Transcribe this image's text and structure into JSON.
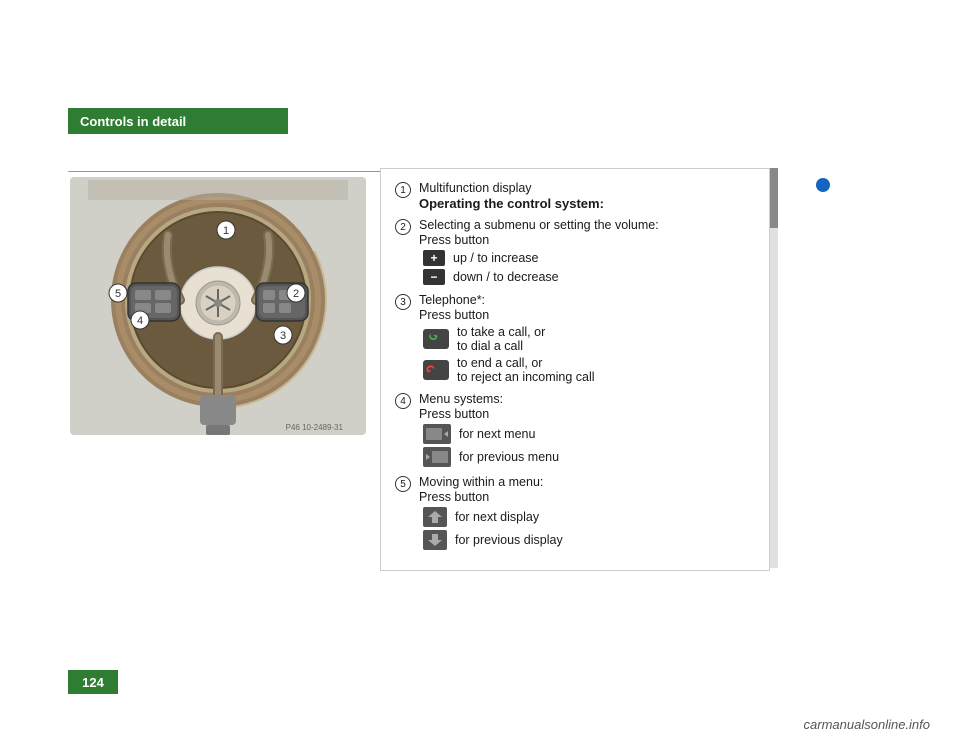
{
  "header": {
    "title": "Controls in detail"
  },
  "page_number": "124",
  "blue_dot_visible": true,
  "content": {
    "items": [
      {
        "number": "1",
        "title": "Multifunction display",
        "subtitle": "Operating the control system:",
        "sub_items": []
      },
      {
        "number": "2",
        "label": "Selecting a submenu or setting the volume:",
        "press": "Press button",
        "icons": [
          {
            "symbol": "+",
            "text": "up / to increase"
          },
          {
            "symbol": "−",
            "text": "down / to decrease"
          }
        ]
      },
      {
        "number": "3",
        "label": "Telephone*:",
        "press": "Press button",
        "icons": [
          {
            "symbol": "call",
            "text": "to take a call, or\nto dial a call"
          },
          {
            "symbol": "end",
            "text": "to end a call, or\nto reject an incoming call"
          }
        ]
      },
      {
        "number": "4",
        "label": "Menu systems:",
        "press": "Press button",
        "icons": [
          {
            "symbol": "next_menu",
            "text": "for next menu"
          },
          {
            "symbol": "prev_menu",
            "text": "for previous menu"
          }
        ]
      },
      {
        "number": "5",
        "label": "Moving within a menu:",
        "press": "Press button",
        "icons": [
          {
            "symbol": "next_display",
            "text": "for next display"
          },
          {
            "symbol": "prev_display",
            "text": "for previous display"
          }
        ]
      }
    ]
  },
  "steering_wheel": {
    "label_numbers": [
      "1",
      "2",
      "3",
      "4",
      "5"
    ],
    "image_caption": "P46 10-2489-31"
  },
  "watermark": "carmanualsonline.info"
}
